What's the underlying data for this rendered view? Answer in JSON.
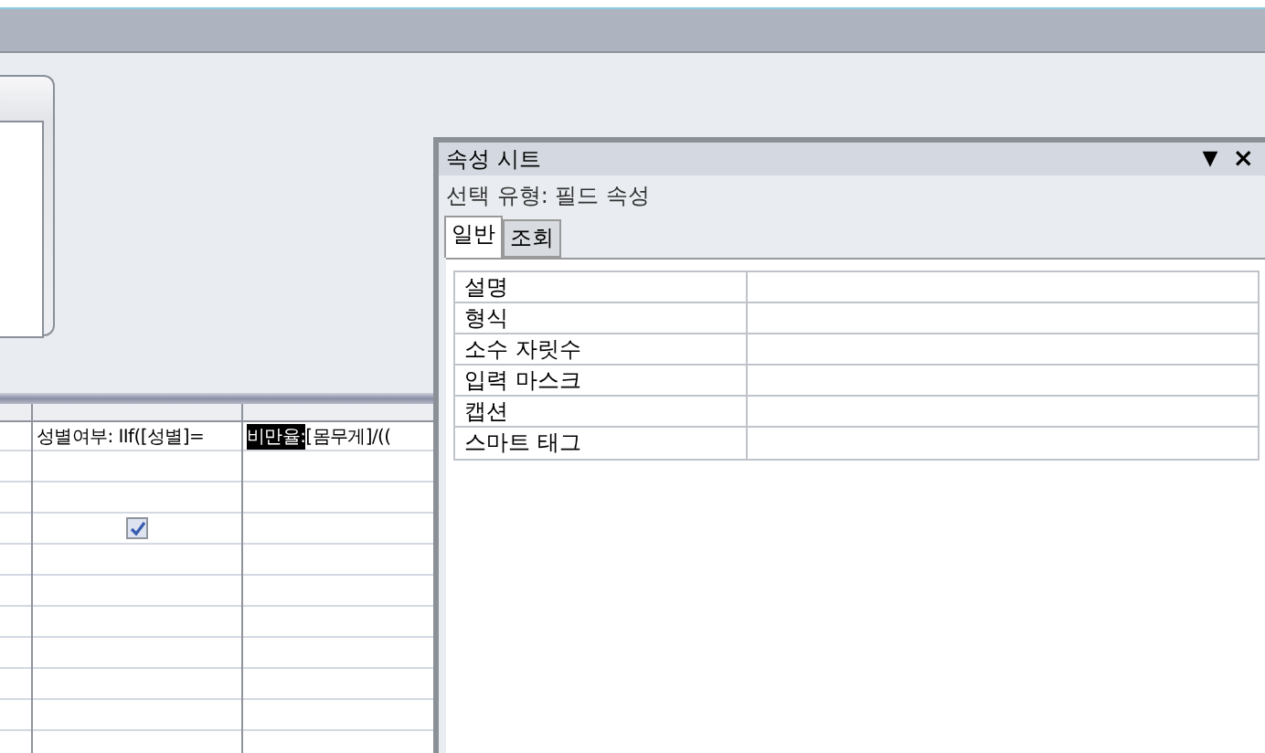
{
  "grid": {
    "columns": [
      {},
      {
        "field": "성별여부: IIf([성별]=",
        "show": true
      },
      {
        "field": "[몸무게]/((",
        "selection": "비만율: "
      }
    ]
  },
  "property_sheet": {
    "title": "속성 시트",
    "close": "×",
    "menu": "▼",
    "selection_type": "선택 유형:  필드 속성",
    "tabs": [
      {
        "label": "일반",
        "selected": true
      },
      {
        "label": "조회",
        "selected": false
      }
    ],
    "properties": [
      {
        "name": "설명"
      },
      {
        "name": "형식"
      },
      {
        "name": "소수 자릿수"
      },
      {
        "name": "입력 마스크"
      },
      {
        "name": "캡션"
      },
      {
        "name": "스마트 태그"
      }
    ]
  }
}
